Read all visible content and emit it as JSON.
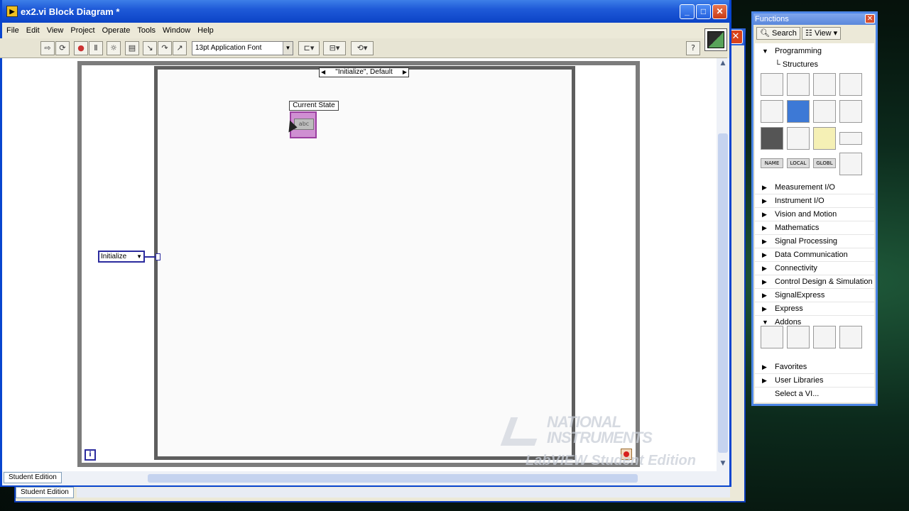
{
  "window": {
    "title": "ex2.vi Block Diagram *",
    "menu": [
      "File",
      "Edit",
      "View",
      "Project",
      "Operate",
      "Tools",
      "Window",
      "Help"
    ],
    "font_select": "13pt Application Font"
  },
  "diagram": {
    "case_selector": "\"Initialize\", Default",
    "current_state_label": "Current State",
    "current_state_inner": "abc",
    "init_constant": "Initialize",
    "iteration_terminal": "i"
  },
  "status": {
    "tab_label": "Student Edition",
    "bg_tab_label": "Student Edition"
  },
  "watermark": {
    "line1": "NATIONAL",
    "line2": "INSTRUMENTS",
    "line3": "LabVIEW Student Edition"
  },
  "palette": {
    "title": "Functions",
    "search_label": "Search",
    "view_label": "View",
    "programming": "Programming",
    "structures": "Structures",
    "categories": [
      "Measurement I/O",
      "Instrument I/O",
      "Vision and Motion",
      "Mathematics",
      "Signal Processing",
      "Data Communication",
      "Connectivity",
      "Control Design & Simulation",
      "SignalExpress",
      "Express"
    ],
    "addons": "Addons",
    "favorites": "Favorites",
    "user_libraries": "User Libraries",
    "select_vi": "Select a VI..."
  }
}
